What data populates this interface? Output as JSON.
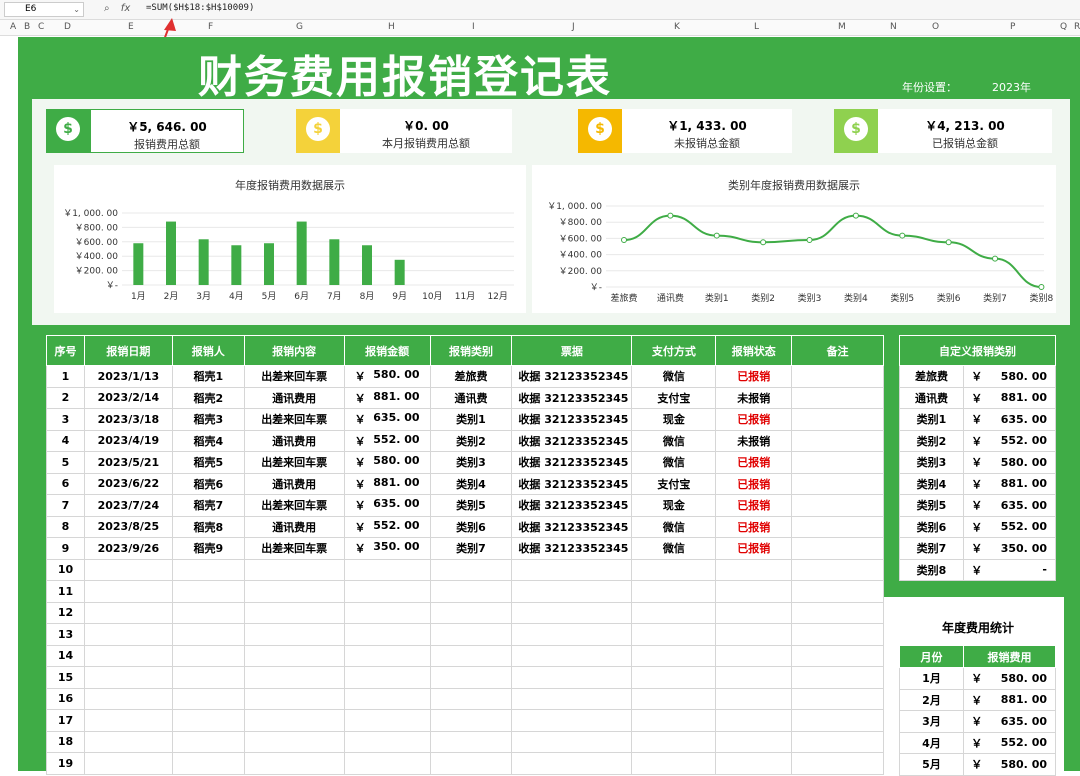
{
  "formula_bar": {
    "cell_ref": "E6",
    "fx_label": "fx",
    "formula": "=SUM($H$18:$H$10009)"
  },
  "columns": [
    "A",
    "B",
    "C",
    "D",
    "E",
    "F",
    "G",
    "H",
    "I",
    "J",
    "K",
    "L",
    "M",
    "N",
    "O",
    "P",
    "Q",
    "R"
  ],
  "title": "财务费用报销登记表",
  "year_label": "年份设置：",
  "year_value": "2023年",
  "cards": [
    {
      "amount": "￥5, 646. 00",
      "label": "报销费用总额",
      "color": "#3fac46"
    },
    {
      "amount": "￥0. 00",
      "label": "本月报销费用总额",
      "color": "#f4d23a"
    },
    {
      "amount": "￥1, 433. 00",
      "label": "未报销总金额",
      "color": "#f5b800"
    },
    {
      "amount": "￥4, 213. 00",
      "label": "已报销总金额",
      "color": "#8fd14f"
    }
  ],
  "chart_data": [
    {
      "type": "bar",
      "title": "年度报销费用数据展示",
      "categories": [
        "1月",
        "2月",
        "3月",
        "4月",
        "5月",
        "6月",
        "7月",
        "8月",
        "9月",
        "10月",
        "11月",
        "12月"
      ],
      "values": [
        580,
        881,
        635,
        552,
        580,
        881,
        635,
        552,
        350,
        0,
        0,
        0
      ],
      "ylim": [
        0,
        1000
      ],
      "yticks": [
        "￥1, 000. 00",
        "￥800. 00",
        "￥600. 00",
        "￥400. 00",
        "￥200. 00",
        "￥-"
      ],
      "color": "#3fac46",
      "grid": true
    },
    {
      "type": "line",
      "title": "类别年度报销费用数据展示",
      "categories": [
        "差旅费",
        "通讯费",
        "类别1",
        "类别2",
        "类别3",
        "类别4",
        "类别5",
        "类别6",
        "类别7",
        "类别8"
      ],
      "values": [
        580,
        881,
        635,
        552,
        580,
        881,
        635,
        552,
        350,
        0
      ],
      "ylim": [
        0,
        1000
      ],
      "yticks": [
        "￥1, 000. 00",
        "￥800. 00",
        "￥600. 00",
        "￥400. 00",
        "￥200. 00",
        "￥-"
      ],
      "color": "#3fac46",
      "grid": true
    }
  ],
  "table": {
    "headers": [
      "序号",
      "报销日期",
      "报销人",
      "报销内容",
      "报销金额",
      "报销类别",
      "票据",
      "支付方式",
      "报销状态",
      "备注"
    ],
    "rows": [
      {
        "no": "1",
        "date": "2023/1/13",
        "person": "稻壳1",
        "content": "出差来回车票",
        "cur": "￥",
        "amount": "580. 00",
        "cat": "差旅费",
        "receipt": "收据 32123352345",
        "pay": "微信",
        "status": "已报销",
        "done": true
      },
      {
        "no": "2",
        "date": "2023/2/14",
        "person": "稻壳2",
        "content": "通讯费用",
        "cur": "￥",
        "amount": "881. 00",
        "cat": "通讯费",
        "receipt": "收据 32123352345",
        "pay": "支付宝",
        "status": "未报销",
        "done": false
      },
      {
        "no": "3",
        "date": "2023/3/18",
        "person": "稻壳3",
        "content": "出差来回车票",
        "cur": "￥",
        "amount": "635. 00",
        "cat": "类别1",
        "receipt": "收据 32123352345",
        "pay": "现金",
        "status": "已报销",
        "done": true
      },
      {
        "no": "4",
        "date": "2023/4/19",
        "person": "稻壳4",
        "content": "通讯费用",
        "cur": "￥",
        "amount": "552. 00",
        "cat": "类别2",
        "receipt": "收据 32123352345",
        "pay": "微信",
        "status": "未报销",
        "done": false
      },
      {
        "no": "5",
        "date": "2023/5/21",
        "person": "稻壳5",
        "content": "出差来回车票",
        "cur": "￥",
        "amount": "580. 00",
        "cat": "类别3",
        "receipt": "收据 32123352345",
        "pay": "微信",
        "status": "已报销",
        "done": true
      },
      {
        "no": "6",
        "date": "2023/6/22",
        "person": "稻壳6",
        "content": "通讯费用",
        "cur": "￥",
        "amount": "881. 00",
        "cat": "类别4",
        "receipt": "收据 32123352345",
        "pay": "支付宝",
        "status": "已报销",
        "done": true
      },
      {
        "no": "7",
        "date": "2023/7/24",
        "person": "稻壳7",
        "content": "出差来回车票",
        "cur": "￥",
        "amount": "635. 00",
        "cat": "类别5",
        "receipt": "收据 32123352345",
        "pay": "现金",
        "status": "已报销",
        "done": true
      },
      {
        "no": "8",
        "date": "2023/8/25",
        "person": "稻壳8",
        "content": "通讯费用",
        "cur": "￥",
        "amount": "552. 00",
        "cat": "类别6",
        "receipt": "收据 32123352345",
        "pay": "微信",
        "status": "已报销",
        "done": true
      },
      {
        "no": "9",
        "date": "2023/9/26",
        "person": "稻壳9",
        "content": "出差来回车票",
        "cur": "￥",
        "amount": "350. 00",
        "cat": "类别7",
        "receipt": "收据 32123352345",
        "pay": "微信",
        "status": "已报销",
        "done": true
      },
      {
        "no": "10"
      },
      {
        "no": "11"
      },
      {
        "no": "12"
      },
      {
        "no": "13"
      },
      {
        "no": "14"
      },
      {
        "no": "15"
      },
      {
        "no": "16"
      },
      {
        "no": "17"
      },
      {
        "no": "18"
      },
      {
        "no": "19"
      }
    ]
  },
  "custom_categories": {
    "header": "自定义报销类别",
    "rows": [
      {
        "cat": "差旅费",
        "cur": "￥",
        "amount": "580. 00"
      },
      {
        "cat": "通讯费",
        "cur": "￥",
        "amount": "881. 00"
      },
      {
        "cat": "类别1",
        "cur": "￥",
        "amount": "635. 00"
      },
      {
        "cat": "类别2",
        "cur": "￥",
        "amount": "552. 00"
      },
      {
        "cat": "类别3",
        "cur": "￥",
        "amount": "580. 00"
      },
      {
        "cat": "类别4",
        "cur": "￥",
        "amount": "881. 00"
      },
      {
        "cat": "类别5",
        "cur": "￥",
        "amount": "635. 00"
      },
      {
        "cat": "类别6",
        "cur": "￥",
        "amount": "552. 00"
      },
      {
        "cat": "类别7",
        "cur": "￥",
        "amount": "350. 00"
      },
      {
        "cat": "类别8",
        "cur": "￥",
        "amount": "-"
      }
    ]
  },
  "annual_stats": {
    "title": "年度费用统计",
    "headers": [
      "月份",
      "报销费用"
    ],
    "rows": [
      {
        "month": "1月",
        "cur": "￥",
        "amount": "580. 00"
      },
      {
        "month": "2月",
        "cur": "￥",
        "amount": "881. 00"
      },
      {
        "month": "3月",
        "cur": "￥",
        "amount": "635. 00"
      },
      {
        "month": "4月",
        "cur": "￥",
        "amount": "552. 00"
      },
      {
        "month": "5月",
        "cur": "￥",
        "amount": "580. 00"
      }
    ]
  }
}
